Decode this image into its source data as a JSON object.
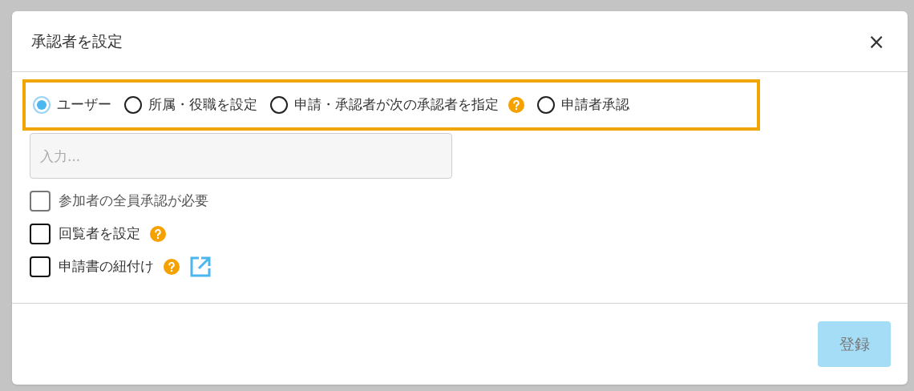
{
  "dialog": {
    "title": "承認者を設定",
    "close": "×"
  },
  "approver_types": [
    {
      "label": "ユーザー",
      "selected": true,
      "help": false
    },
    {
      "label": "所属・役職を設定",
      "selected": false,
      "help": false
    },
    {
      "label": "申請・承認者が次の承認者を指定",
      "selected": false,
      "help": true
    },
    {
      "label": "申請者承認",
      "selected": false,
      "help": false
    }
  ],
  "highlighted": true,
  "input": {
    "placeholder": "入力..."
  },
  "options": [
    {
      "label": "参加者の全員承認が必要",
      "checked": false,
      "disabled": true,
      "help": false,
      "link": false
    },
    {
      "label": "回覧者を設定",
      "checked": false,
      "disabled": false,
      "help": true,
      "link": false
    },
    {
      "label": "申請書の紐付け",
      "checked": false,
      "disabled": false,
      "help": true,
      "link": true
    }
  ],
  "submit": {
    "label": "登録",
    "disabled": true
  }
}
